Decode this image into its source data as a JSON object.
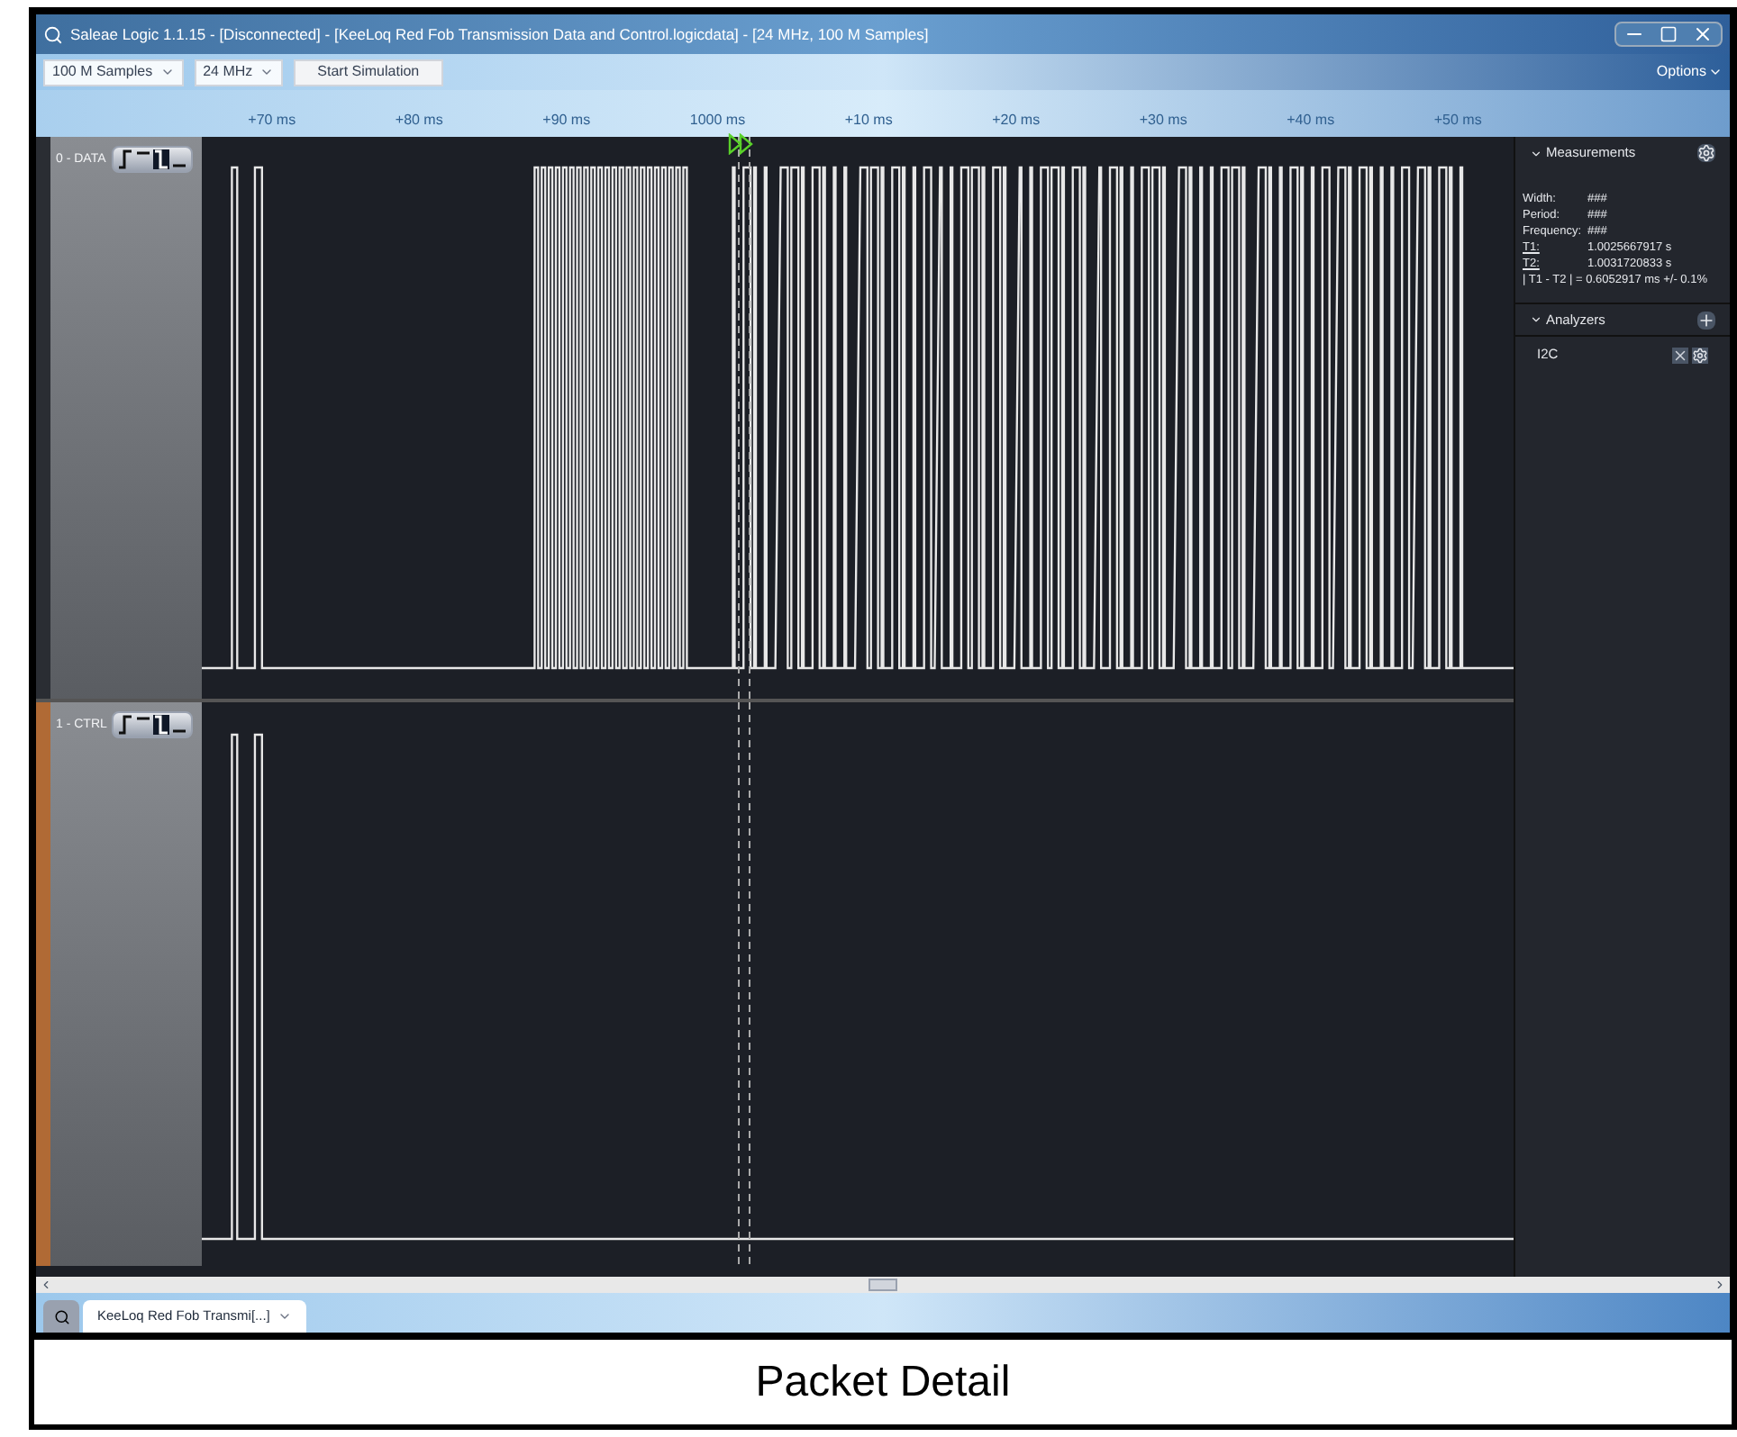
{
  "window": {
    "title": "Saleae Logic 1.1.15 - [Disconnected] - [KeeLoq Red Fob Transmission Data and Control.logicdata] - [24 MHz, 100 M Samples]"
  },
  "toolbar": {
    "samples": "100 M Samples",
    "rate": "24 MHz",
    "start_button": "Start Simulation",
    "options": "Options"
  },
  "ruler": [
    "+70 ms",
    "+80 ms",
    "+90 ms",
    "1000 ms",
    "+10 ms",
    "+20 ms",
    "+30 ms",
    "+40 ms",
    "+50 ms"
  ],
  "channels": [
    {
      "label": "0 - DATA",
      "highlighted": false
    },
    {
      "label": "1 - CTRL",
      "highlighted": true
    }
  ],
  "measurements": {
    "title": "Measurements",
    "rows": [
      {
        "label": "Width:",
        "value": "###",
        "kind": "plain"
      },
      {
        "label": "Period:",
        "value": "###",
        "kind": "plain"
      },
      {
        "label": "Frequency:",
        "value": "###",
        "kind": "plain"
      },
      {
        "label": "T1:",
        "value": "1.0025667917 s",
        "kind": "cursor"
      },
      {
        "label": "T2:",
        "value": "1.0031720833 s",
        "kind": "cursor"
      }
    ],
    "difference": "| T1 - T2 | = 0.6052917 ms +/- 0.1%"
  },
  "analyzers": {
    "title": "Analyzers",
    "items": [
      {
        "name": "I2C"
      }
    ]
  },
  "tabs": [
    {
      "label": "KeeLoq Red Fob Transmi[...]",
      "selected": true
    }
  ],
  "caption": "Packet Detail"
}
